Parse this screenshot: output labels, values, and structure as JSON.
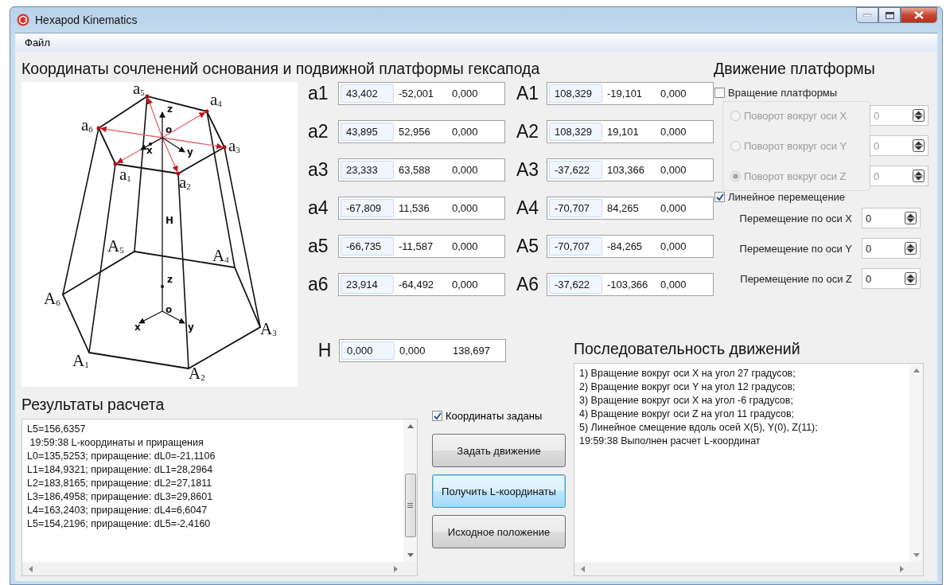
{
  "window": {
    "title": "Hexapod Kinematics"
  },
  "menu": [
    {
      "label": "Файл"
    }
  ],
  "coordinates": {
    "title": "Координаты сочленений основания и подвижной платформы гексапода",
    "diagram": {
      "labels": [
        {
          "kind": "point",
          "text": "a$_{5}$"
        },
        {
          "kind": "point",
          "text": "a$_{4}$"
        },
        {
          "kind": "point",
          "text": "a$_{6}$"
        },
        {
          "kind": "point",
          "text": "a$_{3}$"
        },
        {
          "kind": "point",
          "text": "a$_{1}$"
        },
        {
          "kind": "point",
          "text": "a$_{2}$"
        },
        {
          "kind": "axis",
          "text": "z"
        },
        {
          "kind": "axis",
          "text": "o"
        },
        {
          "kind": "axis",
          "text": "x"
        },
        {
          "kind": "axis",
          "text": "y"
        },
        {
          "kind": "axis",
          "text": "H"
        },
        {
          "kind": "point",
          "text": "A$_{5}$"
        },
        {
          "kind": "point",
          "text": "A$_{4}$"
        },
        {
          "kind": "axis",
          "text": "z"
        },
        {
          "kind": "axis",
          "text": "o"
        },
        {
          "kind": "point",
          "text": "A$_{6}$"
        },
        {
          "kind": "axis",
          "text": "x"
        },
        {
          "kind": "axis",
          "text": "y"
        },
        {
          "kind": "point",
          "text": "A$_{3}$"
        },
        {
          "kind": "point",
          "text": "A$_{1}$"
        },
        {
          "kind": "point",
          "text": "A$_{2}$"
        }
      ]
    },
    "platform_joints": [
      {
        "label": "a1",
        "values": [
          "43,402",
          "-52,001",
          "0,000"
        ]
      },
      {
        "label": "a2",
        "values": [
          "43,895",
          "52,956",
          "0,000"
        ]
      },
      {
        "label": "a3",
        "values": [
          "23,333",
          "63,588",
          "0,000"
        ]
      },
      {
        "label": "a4",
        "values": [
          "-67,809",
          "11,536",
          "0,000"
        ]
      },
      {
        "label": "a5",
        "values": [
          "-66,735",
          "-11,587",
          "0,000"
        ]
      },
      {
        "label": "a6",
        "values": [
          "23,914",
          "-64,492",
          "0,000"
        ]
      }
    ],
    "base_joints": [
      {
        "label": "A1",
        "values": [
          "108,329",
          "-19,101",
          "0,000"
        ]
      },
      {
        "label": "A2",
        "values": [
          "108,329",
          "19,101",
          "0,000"
        ]
      },
      {
        "label": "A3",
        "values": [
          "-37,622",
          "103,366",
          "0,000"
        ]
      },
      {
        "label": "A4",
        "values": [
          "-70,707",
          "84,265",
          "0,000"
        ]
      },
      {
        "label": "A5",
        "values": [
          "-70,707",
          "-84,265",
          "0,000"
        ]
      },
      {
        "label": "A6",
        "values": [
          "-37,622",
          "-103,366",
          "0,000"
        ]
      }
    ],
    "height": {
      "label": "H",
      "values": [
        "0,000",
        "0,000",
        "138,697"
      ]
    }
  },
  "motion": {
    "title": "Движение платформы",
    "rotation": {
      "label": "Вращение платформы",
      "checked": false,
      "axes": [
        {
          "label": "Поворот вокруг оси X",
          "selected": false,
          "value": "0"
        },
        {
          "label": "Поворот вокруг оси Y",
          "selected": false,
          "value": "0"
        },
        {
          "label": "Поворот вокруг оси Z",
          "selected": true,
          "value": "0"
        }
      ]
    },
    "translation": {
      "label": "Линейное перемещение",
      "checked": true,
      "axes": [
        {
          "label": "Перемещение по оси X",
          "value": "0"
        },
        {
          "label": "Перемещение по оси Y",
          "value": "0"
        },
        {
          "label": "Перемещение по оси Z",
          "value": "0"
        }
      ]
    }
  },
  "results": {
    "title": "Результаты расчета",
    "lines": [
      "L5=156,6357",
      " 19:59:38 L-координаты и приращения",
      "L0=135,5253; приращение: dL0=-21,1106",
      "L1=184,9321; приращение: dL1=28,2964",
      "L2=183,8165; приращение: dL2=27,1811",
      "L3=186,4958; приращение: dL3=29,8601",
      "L4=163,2403; приращение: dL4=6,6047",
      "L5=154,2196; приращение: dL5=-2,4160"
    ]
  },
  "coordinates_set": {
    "label": "Координаты заданы",
    "checked": true
  },
  "buttons": [
    {
      "label": "Задать движение",
      "focused": false
    },
    {
      "label": "Получить L-координаты",
      "focused": true
    },
    {
      "label": "Исходное положение",
      "focused": false
    }
  ],
  "sequence": {
    "title": "Последовательность движений",
    "lines": [
      "1) Вращение вокруг оси X на угол 27 градусов;",
      "2) Вращение вокруг оси Y на угол 12 градусов;",
      "3) Вращение вокруг оси X на угол -6 градусов;",
      "4) Вращение вокруг оси Z на угол 11 градусов;",
      "5) Линейное смещение вдоль осей X(5), Y(0), Z(11);",
      "19:59:38 Выполнен расчет L-координат"
    ]
  }
}
